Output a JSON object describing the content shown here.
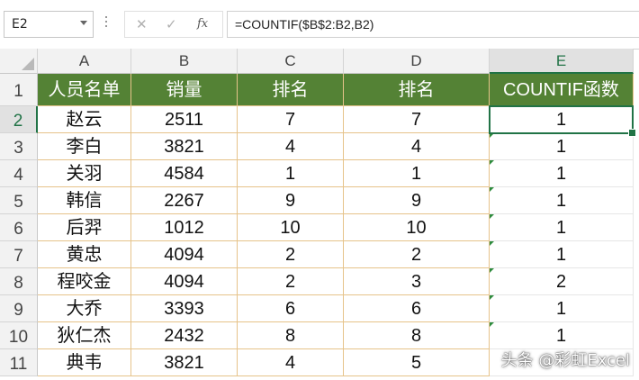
{
  "formula_bar": {
    "name_box": "E2",
    "cancel_icon": "x-icon",
    "enter_icon": "check-icon",
    "fx_label": "fx",
    "formula": "=COUNTIF($B$2:B2,B2)"
  },
  "columns": [
    "A",
    "B",
    "C",
    "D",
    "E"
  ],
  "selected_column": "E",
  "row_numbers": [
    "1",
    "2",
    "3",
    "4",
    "5",
    "6",
    "7",
    "8",
    "9",
    "10",
    "11"
  ],
  "selected_row": "2",
  "table": {
    "headers": [
      "人员名单",
      "销量",
      "排名",
      "排名",
      "COUNTIF函数"
    ],
    "rows": [
      [
        "赵云",
        "2511",
        "7",
        "7",
        "1"
      ],
      [
        "李白",
        "3821",
        "4",
        "4",
        "1"
      ],
      [
        "关羽",
        "4584",
        "1",
        "1",
        "1"
      ],
      [
        "韩信",
        "2267",
        "9",
        "9",
        "1"
      ],
      [
        "后羿",
        "1012",
        "10",
        "10",
        "1"
      ],
      [
        "黄忠",
        "4094",
        "2",
        "2",
        "1"
      ],
      [
        "程咬金",
        "4094",
        "2",
        "3",
        "2"
      ],
      [
        "大乔",
        "3393",
        "6",
        "6",
        "1"
      ],
      [
        "狄仁杰",
        "2432",
        "8",
        "8",
        "1"
      ],
      [
        "典韦",
        "3821",
        "4",
        "5",
        ""
      ]
    ]
  },
  "colors": {
    "header_fill": "#548235",
    "selection": "#217346",
    "cell_border": "#e6c38a"
  },
  "watermark": "头条 @彩虹Excel"
}
